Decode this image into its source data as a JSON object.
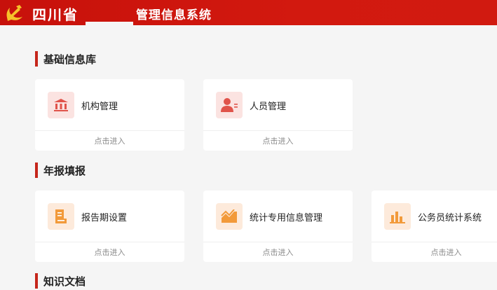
{
  "header": {
    "province": "四川省",
    "system_name": "管理信息系统"
  },
  "sections": [
    {
      "title": "基础信息库",
      "cards": [
        {
          "label": "机构管理",
          "enter": "点击进入",
          "icon": "building-icon"
        },
        {
          "label": "人员管理",
          "enter": "点击进入",
          "icon": "person-icon"
        }
      ]
    },
    {
      "title": "年报填报",
      "cards": [
        {
          "label": "报告期设置",
          "enter": "点击进入",
          "icon": "report-icon"
        },
        {
          "label": "统计专用信息管理",
          "enter": "点击进入",
          "icon": "trend-chart-icon"
        },
        {
          "label": "公务员统计系统",
          "enter": "点击进入",
          "icon": "bar-chart-icon"
        }
      ]
    },
    {
      "title": "知识文档",
      "cards": []
    }
  ],
  "colors": {
    "header_red": "#c7110b",
    "accent_bar": "#c5261b",
    "icon_red": "#e0534a",
    "icon_orange": "#f29a3a"
  }
}
